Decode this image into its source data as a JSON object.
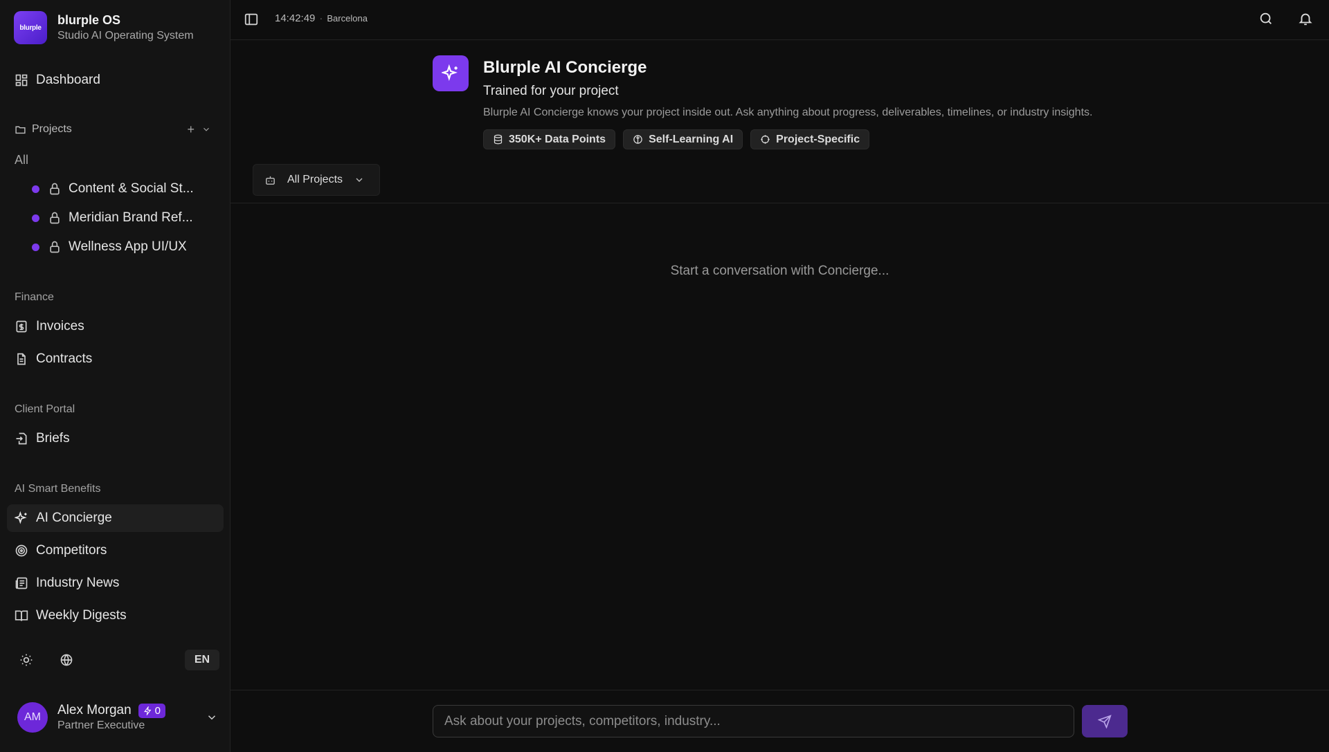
{
  "brand": {
    "logo_text": "blurple",
    "title": "blurple OS",
    "subtitle": "Studio AI Operating System"
  },
  "nav": {
    "dashboard": "Dashboard"
  },
  "projects": {
    "label": "Projects",
    "add": "+",
    "all": "All",
    "items": [
      {
        "name": "Content & Social St...",
        "color": "#7c3aed"
      },
      {
        "name": "Meridian Brand Ref...",
        "color": "#7c3aed"
      },
      {
        "name": "Wellness App UI/UX",
        "color": "#7c3aed"
      }
    ]
  },
  "finance": {
    "label": "Finance",
    "items": [
      "Invoices",
      "Contracts"
    ]
  },
  "client_portal": {
    "label": "Client Portal",
    "items": [
      "Briefs"
    ]
  },
  "ai_benefits": {
    "label": "AI Smart Benefits",
    "items": [
      "AI Concierge",
      "Competitors",
      "Industry News",
      "Weekly Digests"
    ]
  },
  "tools": {
    "language": "EN"
  },
  "user": {
    "initials": "AM",
    "name": "Alex Morgan",
    "credits": "0",
    "role": "Partner Executive"
  },
  "topbar": {
    "time": "14:42:49",
    "separator": "·",
    "city": "Barcelona"
  },
  "hero": {
    "title": "Blurple AI Concierge",
    "subtitle": "Trained for your project",
    "description": "Blurple AI Concierge knows your project inside out. Ask anything about progress, deliverables, timelines, or industry insights.",
    "chips": [
      "350K+ Data Points",
      "Self-Learning AI",
      "Project-Specific"
    ]
  },
  "filter": {
    "selected": "All Projects"
  },
  "chat": {
    "empty_state": "Start a conversation with Concierge...",
    "placeholder": "Ask about your projects, competitors, industry..."
  },
  "colors": {
    "accent": "#7c3aed",
    "background": "#0e0e0e",
    "sidebar": "#141414"
  }
}
